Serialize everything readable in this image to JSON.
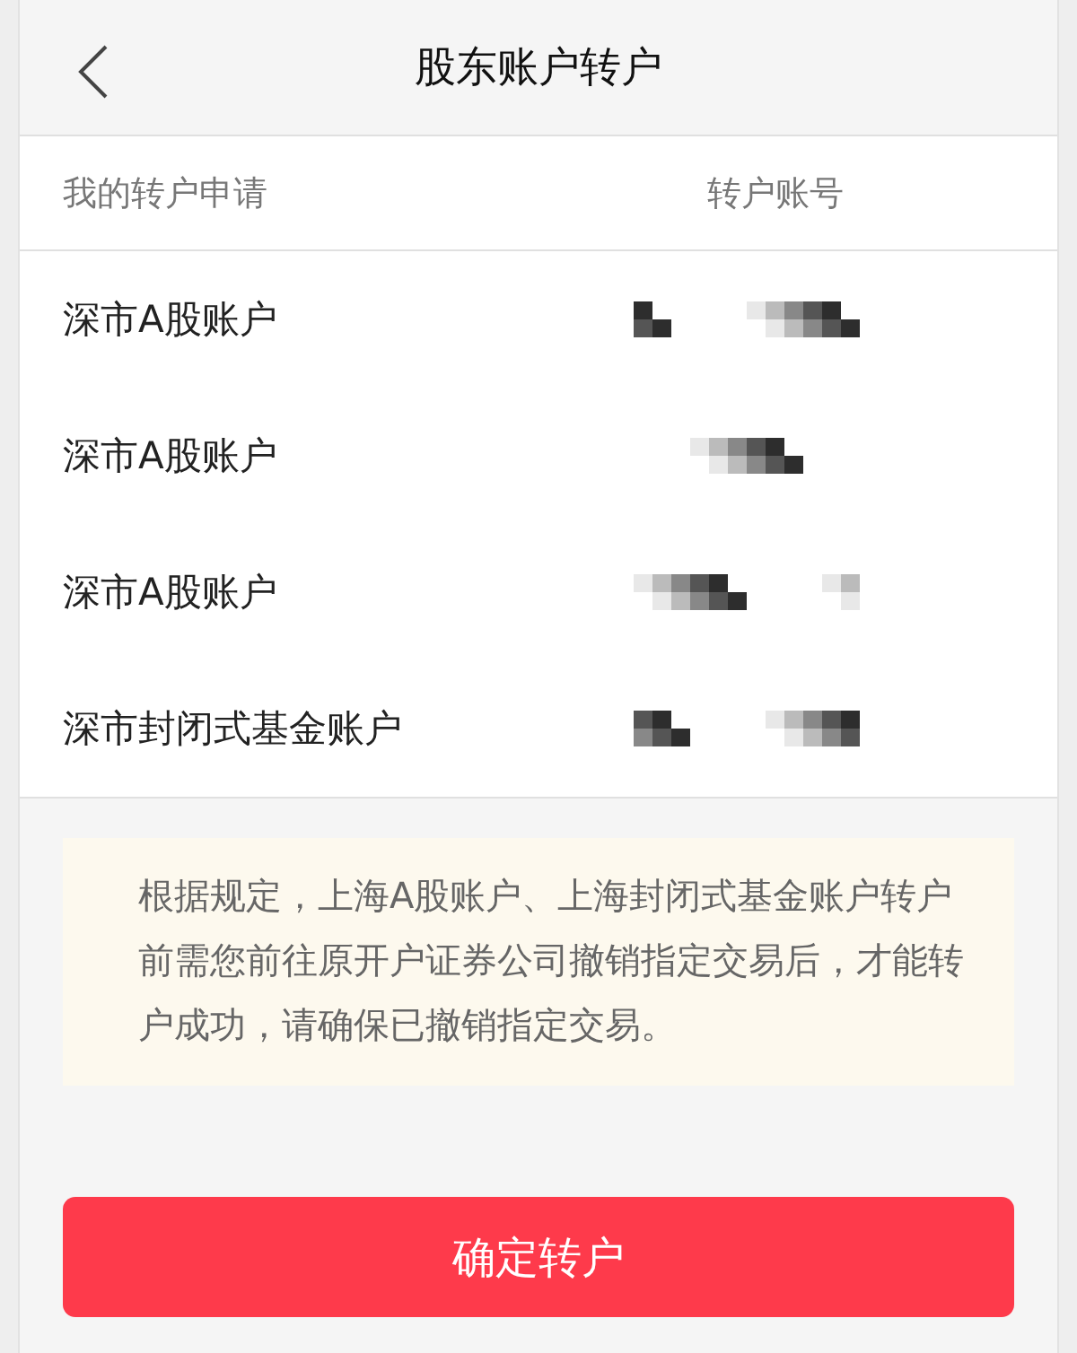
{
  "header": {
    "title": "股东账户转户"
  },
  "table": {
    "columns": [
      "我的转户申请",
      "转户账号"
    ],
    "rows": [
      {
        "account_type": "深市A股账户"
      },
      {
        "account_type": "深市A股账户"
      },
      {
        "account_type": "深市A股账户"
      },
      {
        "account_type": "深市封闭式基金账户"
      }
    ]
  },
  "notice": "根据规定，上海A股账户、上海封闭式基金账户转户前需您前往原开户证券公司撤销指定交易后，才能转户成功，请确保已撤销指定交易。",
  "confirm_button": "确定转户"
}
